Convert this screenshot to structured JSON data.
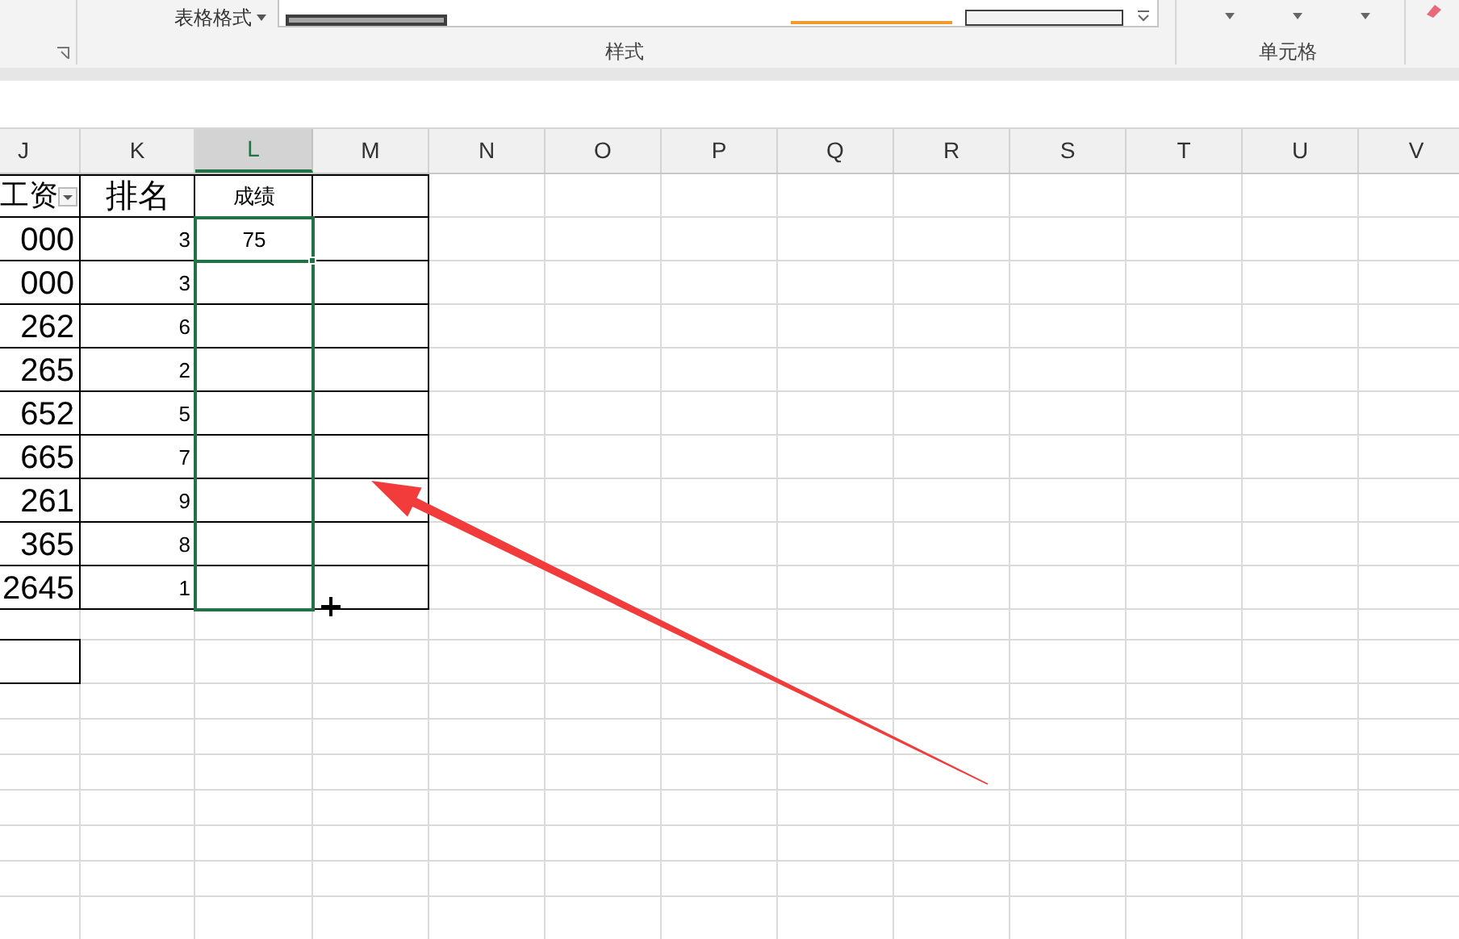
{
  "ribbon": {
    "format_table_label": "表格格式",
    "groups": [
      {
        "label": "样式"
      },
      {
        "label": "单元格"
      }
    ]
  },
  "columns": [
    {
      "label": "J",
      "selected": false
    },
    {
      "label": "K",
      "selected": false
    },
    {
      "label": "L",
      "selected": true
    },
    {
      "label": "M",
      "selected": false
    },
    {
      "label": "N",
      "selected": false
    },
    {
      "label": "O",
      "selected": false
    },
    {
      "label": "P",
      "selected": false
    },
    {
      "label": "Q",
      "selected": false
    },
    {
      "label": "R",
      "selected": false
    },
    {
      "label": "S",
      "selected": false
    },
    {
      "label": "T",
      "selected": false
    },
    {
      "label": "U",
      "selected": false
    },
    {
      "label": "V",
      "selected": false
    }
  ],
  "header_row": {
    "salary": "工资",
    "rank": "排名",
    "score": "成绩"
  },
  "rows": [
    {
      "salary": "000",
      "rank": "3",
      "score": "75"
    },
    {
      "salary": "000",
      "rank": "3"
    },
    {
      "salary": "262",
      "rank": "6"
    },
    {
      "salary": "265",
      "rank": "2"
    },
    {
      "salary": "652",
      "rank": "5"
    },
    {
      "salary": "665",
      "rank": "7"
    },
    {
      "salary": "261",
      "rank": "9"
    },
    {
      "salary": "365",
      "rank": "8"
    },
    {
      "salary": "2645",
      "rank": "1"
    }
  ]
}
